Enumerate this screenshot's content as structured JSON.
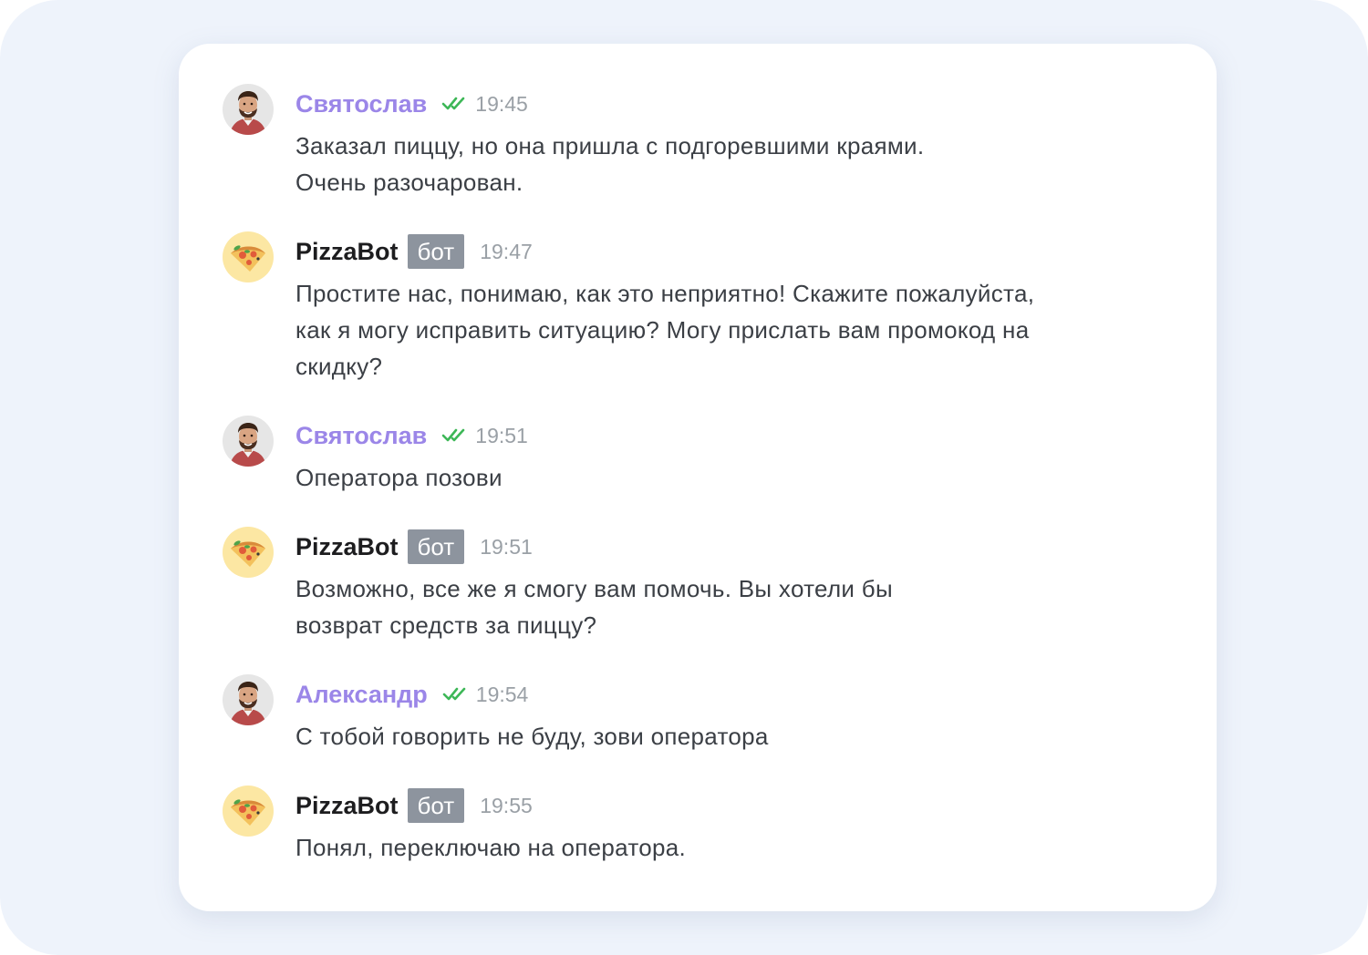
{
  "messages": [
    {
      "author": "Святослав",
      "type": "user",
      "time": "19:45",
      "lines": [
        "Заказал пиццу, но она пришла с подгоревшими краями.",
        "Очень разочарован."
      ]
    },
    {
      "author": "PizzaBot",
      "type": "bot",
      "badge": "бот",
      "time": "19:47",
      "lines": [
        "Простите нас, понимаю, как это неприятно! Скажите пожалуйста,",
        "как я могу исправить ситуацию? Могу прислать вам промокод на",
        "скидку?"
      ]
    },
    {
      "author": "Святослав",
      "type": "user",
      "time": "19:51",
      "lines": [
        "Оператора позови"
      ]
    },
    {
      "author": "PizzaBot",
      "type": "bot",
      "badge": "бот",
      "time": "19:51",
      "lines": [
        "Возможно, все же я смогу вам помочь. Вы хотели бы",
        "возврат средств за пиццу?"
      ]
    },
    {
      "author": "Александр",
      "type": "user",
      "time": "19:54",
      "lines": [
        "С тобой говорить не буду, зови оператора"
      ]
    },
    {
      "author": "PizzaBot",
      "type": "bot",
      "badge": "бот",
      "time": "19:55",
      "lines": [
        "Понял, переключаю на оператора."
      ]
    }
  ],
  "icons": {
    "user_avatar": "man-avatar-icon",
    "bot_avatar": "pizza-icon",
    "read_status": "double-check-icon"
  },
  "colors": {
    "user_name": "#9b86e8",
    "bot_name": "#1d1d1f",
    "badge_bg": "#8d949e",
    "check": "#3db757",
    "time": "#9aa0a6",
    "text": "#3b3f45",
    "page_bg": "#eef3fb"
  }
}
